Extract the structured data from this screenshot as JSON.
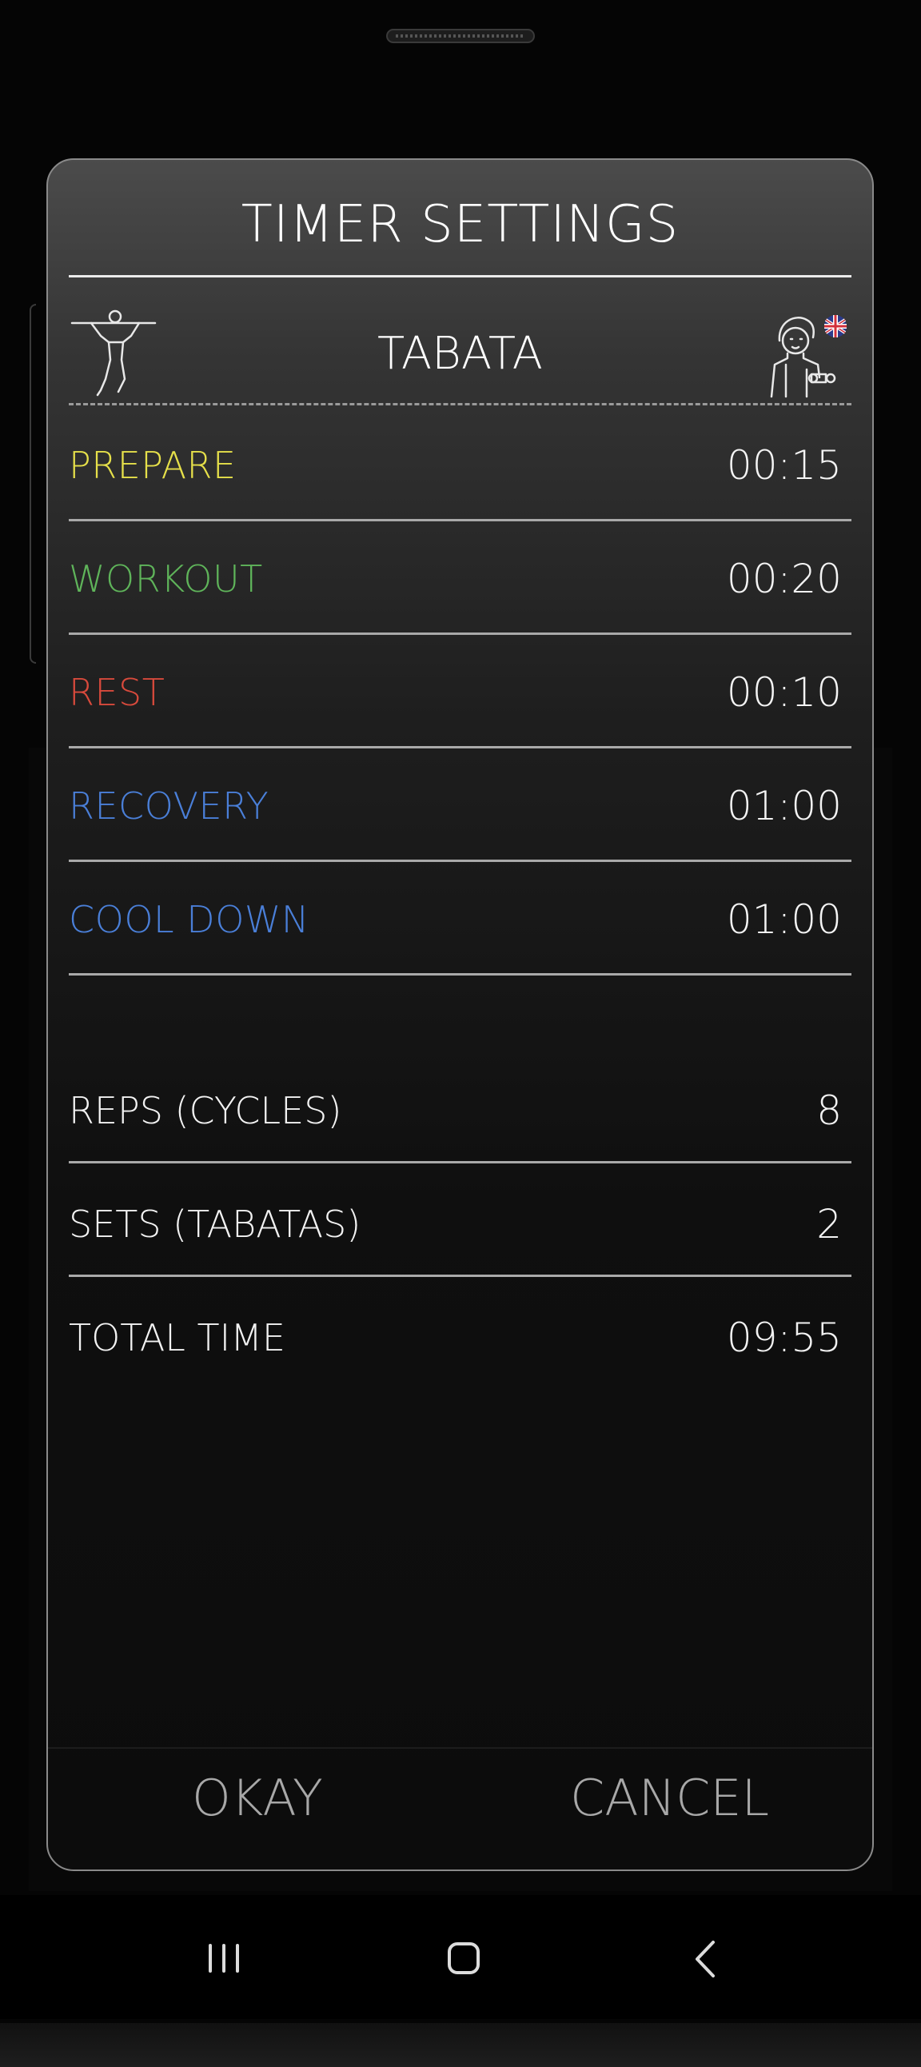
{
  "dialog": {
    "title": "TIMER SETTINGS",
    "workout_name": "TABATA",
    "left_icon": "pull-up-figure-icon",
    "right_icon": "trainer-avatar-uk-flag-icon"
  },
  "intervals": [
    {
      "label": "PREPARE",
      "value": "00:15",
      "color": "#e6e04a"
    },
    {
      "label": "WORKOUT",
      "value": "00:20",
      "color": "#5fb45a"
    },
    {
      "label": "REST",
      "value": "00:10",
      "color": "#d84a3c"
    },
    {
      "label": "RECOVERY",
      "value": "01:00",
      "color": "#4a7fd8"
    },
    {
      "label": "COOL DOWN",
      "value": "01:00",
      "color": "#4a7fd8"
    }
  ],
  "summary": {
    "reps_label": "REPS (CYCLES)",
    "reps_value": "8",
    "sets_label": "SETS (TABATAS)",
    "sets_value": "2",
    "total_label": "TOTAL TIME",
    "total_value": "09:55"
  },
  "buttons": {
    "okay": "OKAY",
    "cancel": "CANCEL"
  },
  "nav": {
    "recents_icon": "recent-apps-icon",
    "home_icon": "home-icon",
    "back_icon": "back-icon"
  }
}
